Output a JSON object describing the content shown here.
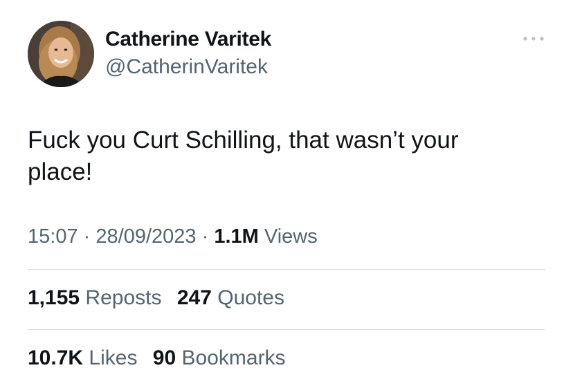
{
  "author": {
    "display_name": "Catherine Varitek",
    "handle": "@CatherinVaritek",
    "avatar_icon": "profile-photo"
  },
  "more_icon": "ellipsis-icon",
  "tweet": {
    "text_line1": "Fuck you Curt Schilling, that wasn’t your",
    "text_line2": "place!"
  },
  "meta": {
    "time": "15:07",
    "separator": "·",
    "date": "28/09/2023",
    "views_count": "1.1M",
    "views_label": "Views"
  },
  "stats": {
    "reposts_count": "1,155",
    "reposts_label": "Reposts",
    "quotes_count": "247",
    "quotes_label": "Quotes",
    "likes_count": "10.7K",
    "likes_label": "Likes",
    "bookmarks_count": "90",
    "bookmarks_label": "Bookmarks"
  },
  "colors": {
    "primary_text": "#0f1419",
    "secondary_text": "#536471",
    "divider": "#d9dde1"
  }
}
